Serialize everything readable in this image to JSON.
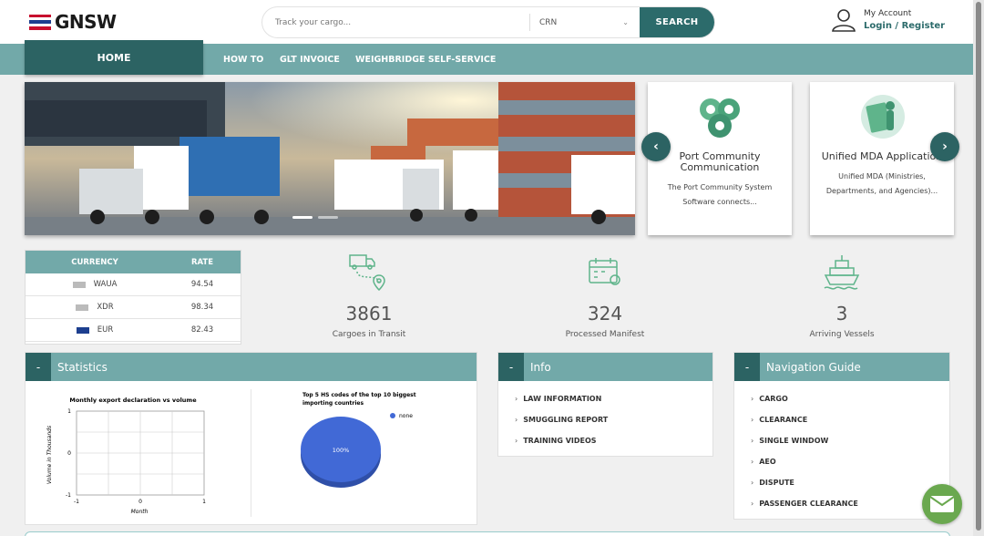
{
  "header": {
    "logo_text": "GNSW",
    "search": {
      "placeholder": "Track your cargo...",
      "select_value": "CRN",
      "button_label": "SEARCH"
    },
    "account": {
      "label": "My Account",
      "link": "Login / Register"
    }
  },
  "nav": {
    "home": "HOME",
    "items": [
      "HOW TO",
      "GLT INVOICE",
      "WEIGHBRIDGE SELF-SERVICE"
    ]
  },
  "cards": [
    {
      "title": "Port Community Communication",
      "desc": "The Port Community System Software connects..."
    },
    {
      "title": "Unified MDA Application",
      "desc": "Unified MDA (Ministries, Departments, and Agencies)..."
    }
  ],
  "currency": {
    "headers": [
      "CURRENCY",
      "RATE"
    ],
    "rows": [
      {
        "code": "WAUA",
        "rate": "94.54"
      },
      {
        "code": "XDR",
        "rate": "98.34"
      },
      {
        "code": "EUR",
        "rate": "82.43"
      }
    ]
  },
  "stats": [
    {
      "value": "3861",
      "label": "Cargoes in Transit",
      "icon": "truck-route-icon"
    },
    {
      "value": "324",
      "label": "Processed Manifest",
      "icon": "calendar-icon"
    },
    {
      "value": "3",
      "label": "Arriving Vessels",
      "icon": "ship-icon"
    }
  ],
  "panels": {
    "statistics": {
      "title": "Statistics"
    },
    "info": {
      "title": "Info",
      "items": [
        "LAW INFORMATION",
        "SMUGGLING REPORT",
        "TRAINING VIDEOS"
      ]
    },
    "nav_guide": {
      "title": "Navigation Guide",
      "items": [
        "CARGO",
        "CLEARANCE",
        "SINGLE WINDOW",
        "AEO",
        "DISPUTE",
        "PASSENGER CLEARANCE"
      ]
    }
  },
  "chart_data": [
    {
      "type": "scatter",
      "title": "Monthly export declaration vs volume",
      "xlabel": "Month",
      "ylabel": "Volume in Thousands",
      "x_ticks": [
        "-1",
        "0",
        "1"
      ],
      "y_ticks": [
        "1",
        "0",
        "-1"
      ],
      "xlim": [
        -1,
        1
      ],
      "ylim": [
        -1,
        1
      ],
      "grid": true,
      "series": []
    },
    {
      "type": "pie",
      "title_line1": "Top 5 HS codes of the top 10 biggest",
      "title_line2": "importing countries",
      "legend": "top-right",
      "slices": [
        {
          "name": "none",
          "value": 100,
          "label": "100%",
          "color": "#4169d6"
        }
      ]
    }
  ],
  "colors": {
    "brand": "#2c6363",
    "nav": "#72a9a9",
    "accent": "#2c6b6b",
    "mail": "#6aa84f"
  }
}
